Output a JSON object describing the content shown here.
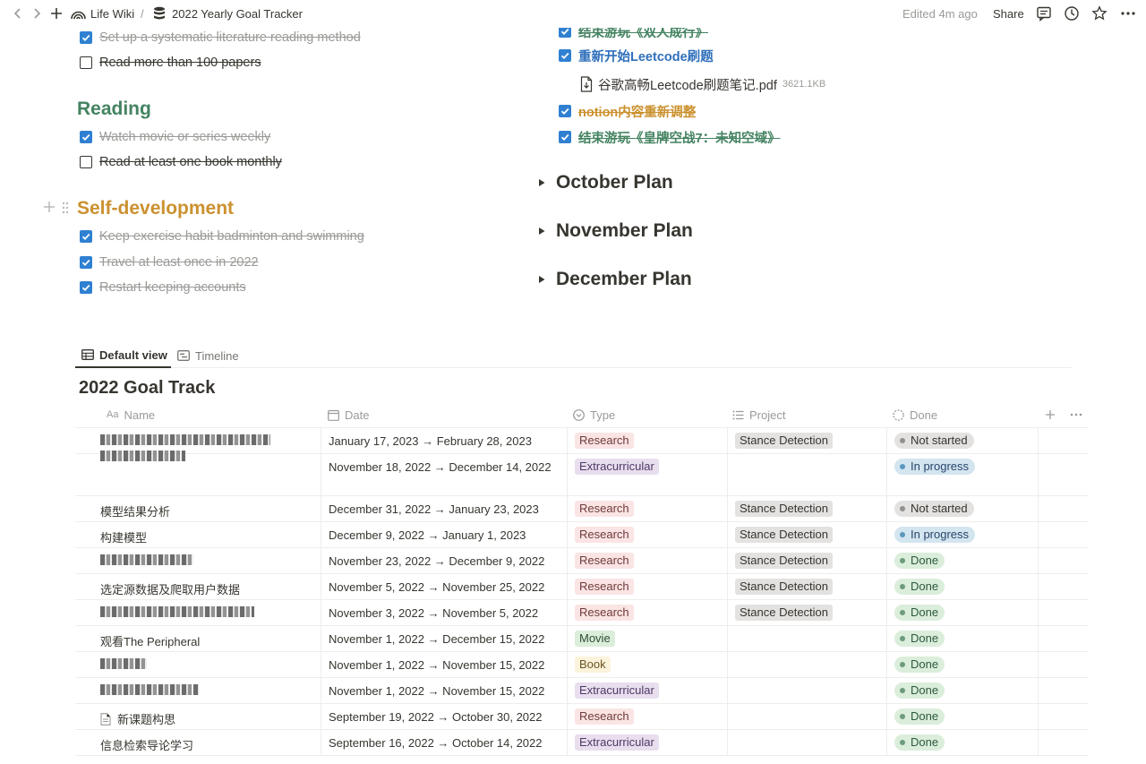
{
  "topbar": {
    "workspace": "Life Wiki",
    "separator": "/",
    "page_title": "2022 Yearly Goal Tracker",
    "edited": "Edited 4m ago",
    "share": "Share",
    "icons": [
      "chevron-left-icon",
      "chevron-right-icon",
      "plus-icon",
      "wiki-icon",
      "database-icon",
      "comment-icon",
      "history-icon",
      "star-icon",
      "more-icon"
    ]
  },
  "left_column": {
    "top_todos": [
      {
        "label": "Set up a systematic literature reading method",
        "checked": true
      },
      {
        "label": "Read more than 100 papers",
        "checked": false
      }
    ],
    "reading": {
      "heading": "Reading",
      "todos": [
        {
          "label": "Watch movie or series weekly",
          "checked": true
        },
        {
          "label": "Read at least one book monthly",
          "checked": false
        }
      ]
    },
    "self_development": {
      "heading": "Self-development",
      "todos": [
        {
          "label": "Keep exercise habit badminton and swimming",
          "checked": true
        },
        {
          "label": "Travel at least once in 2022",
          "checked": true
        },
        {
          "label": "Restart keeping accounts",
          "checked": true
        }
      ]
    }
  },
  "right_column": {
    "todos_top": [
      {
        "label": "结束游玩《双人成行》",
        "checked": true
      },
      {
        "label": "重新开始Leetcode刷题",
        "checked": true
      }
    ],
    "attachment": {
      "name": "谷歌高畅Leetcode刷题笔记.pdf",
      "size": "3621.1KB"
    },
    "todos_bottom": [
      {
        "label": "notion内容重新调整",
        "checked": true
      },
      {
        "label": "结束游玩《皇牌空战7：未知空域》",
        "checked": true
      }
    ],
    "toggles": [
      "October Plan",
      "November Plan",
      "December Plan"
    ]
  },
  "views": {
    "tabs": [
      "Default view",
      "Timeline"
    ],
    "active": "Default view"
  },
  "database": {
    "title": "2022 Goal Track",
    "columns": {
      "name": "Name",
      "date": "Date",
      "type": "Type",
      "project": "Project",
      "done": "Done"
    },
    "colors": {
      "research": "#fbe4e4",
      "extracurricular": "#e8deee",
      "movie": "#dbeddb",
      "book": "#fbf3db",
      "done": "#dbeddb",
      "in_progress": "#d3e5ef",
      "not_started": "#e3e2e0"
    },
    "rows": [
      {
        "name": "论文撰写",
        "date": "January 17, 2023 → February 28, 2023",
        "type": "Research",
        "project": "Stance Detection",
        "status": "Not started"
      },
      {
        "name": "",
        "date": "November 18, 2022 → December 14, 2022",
        "type": "Extracurricular",
        "project": "",
        "status": "In progress"
      },
      {
        "name": "模型结果分析",
        "date": "December 31, 2022 → January 23, 2023",
        "type": "Research",
        "project": "Stance Detection",
        "status": "Not started"
      },
      {
        "name": "构建模型",
        "date": "December 9, 2022 → January 1, 2023",
        "type": "Research",
        "project": "Stance Detection",
        "status": "In progress"
      },
      {
        "name": "",
        "date": "November 23, 2022 → December 9, 2022",
        "type": "Research",
        "project": "Stance Detection",
        "status": "Done"
      },
      {
        "name": "选定源数据及爬取用户数据",
        "date": "November 5, 2022 → November 25, 2022",
        "type": "Research",
        "project": "Stance Detection",
        "status": "Done"
      },
      {
        "name": "",
        "date": "November 3, 2022 → November 5, 2022",
        "type": "Research",
        "project": "Stance Detection",
        "status": "Done"
      },
      {
        "name": "观看The Peripheral",
        "date": "November 1, 2022 → December 15, 2022",
        "type": "Movie",
        "project": "",
        "status": "Done"
      },
      {
        "name": "",
        "date": "November 1, 2022 → November 15, 2022",
        "type": "Book",
        "project": "",
        "status": "Done"
      },
      {
        "name": "",
        "date": "November 1, 2022 → November 15, 2022",
        "type": "Extracurricular",
        "project": "",
        "status": "Done"
      },
      {
        "name": "新课题构思",
        "date": "September 19, 2022 → October 30, 2022",
        "type": "Research",
        "project": "",
        "status": "Done"
      },
      {
        "name": "信息检索导论学习",
        "date": "September 16, 2022 → October 14, 2022",
        "type": "Extracurricular",
        "project": "",
        "status": "Done"
      }
    ]
  }
}
